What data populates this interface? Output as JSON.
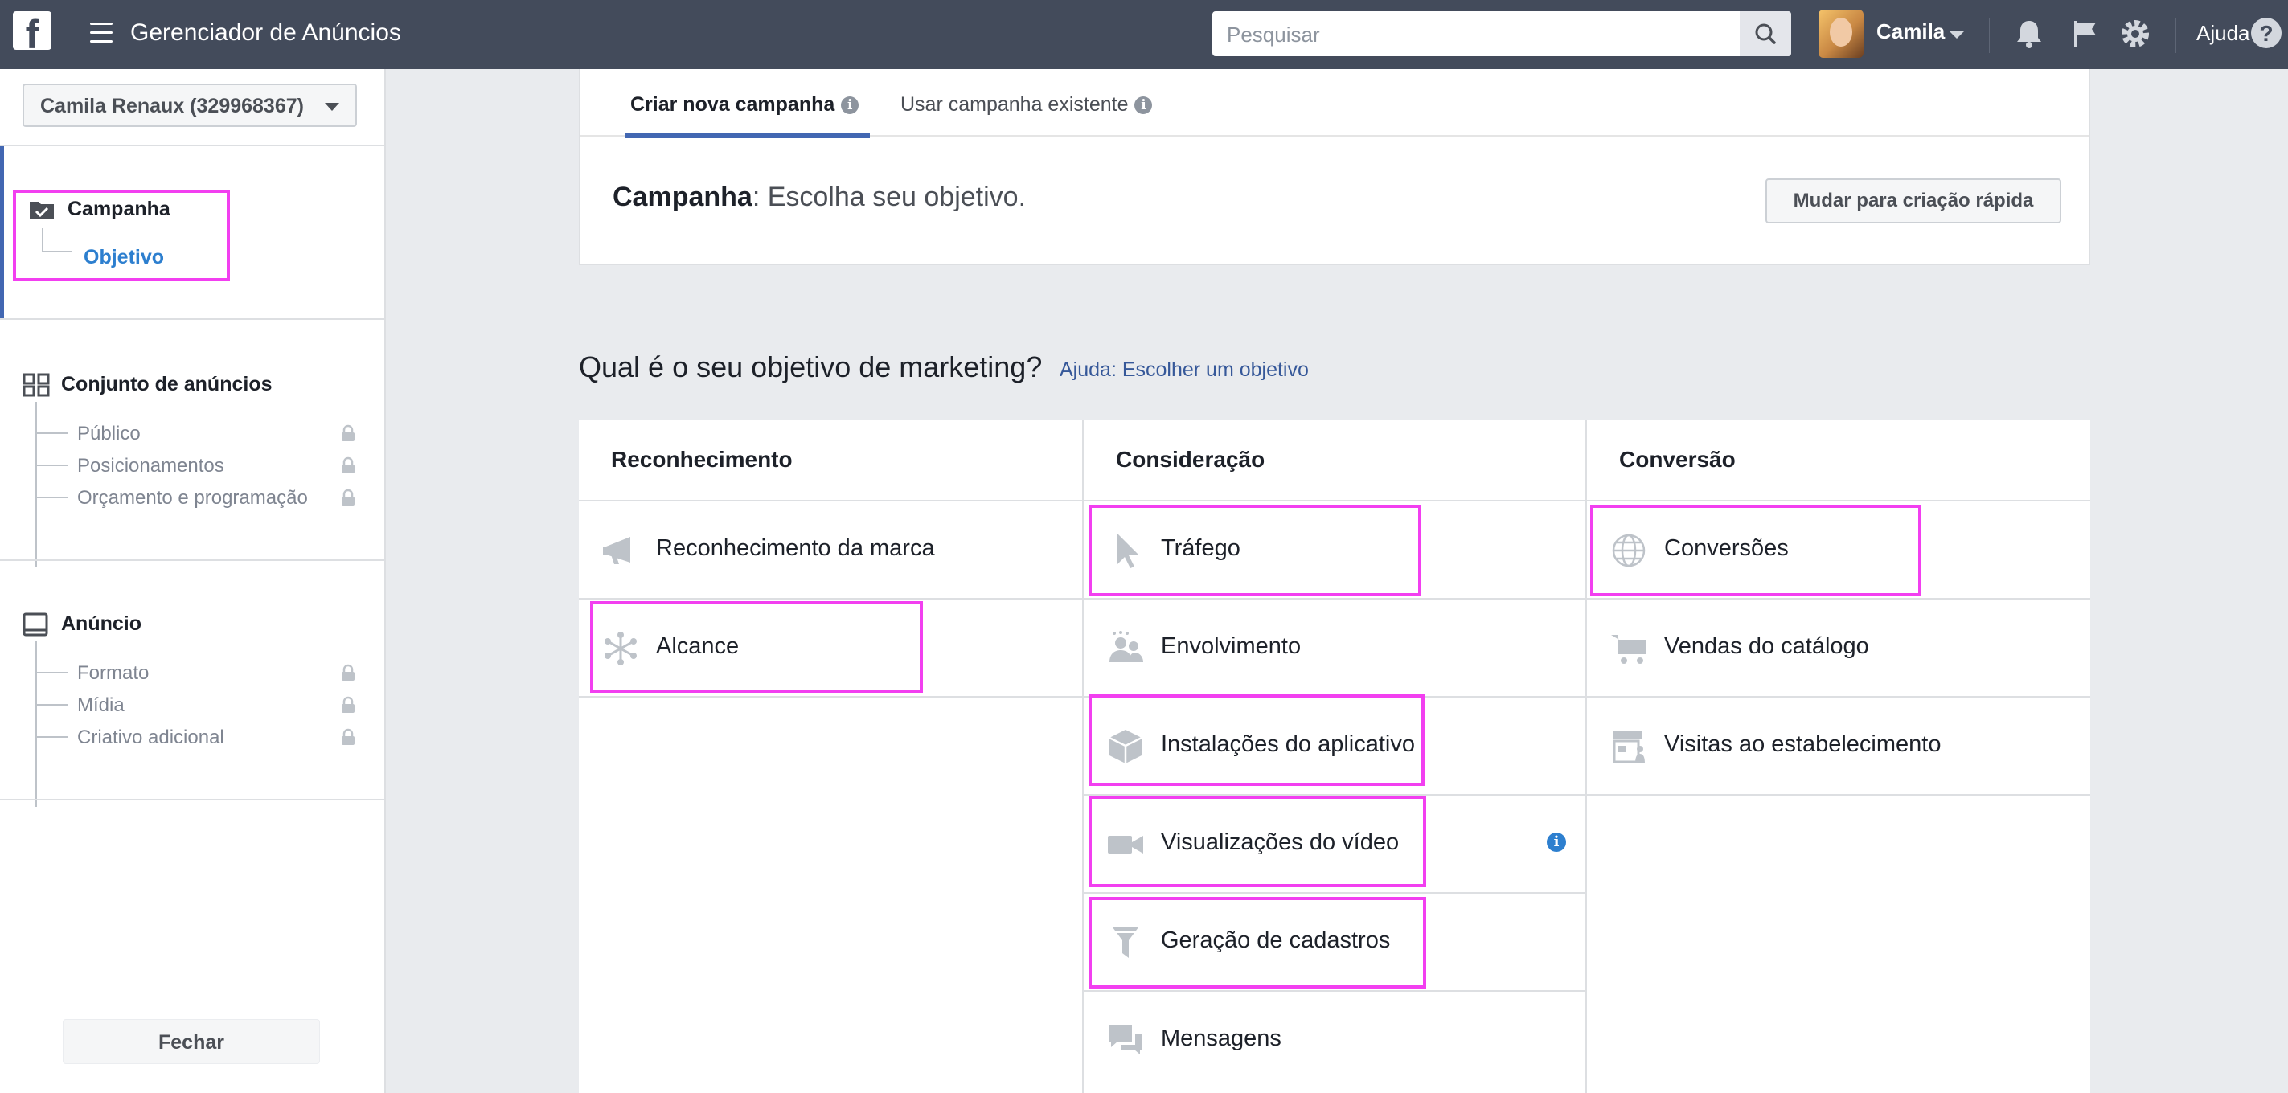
{
  "topbar": {
    "logo": "f",
    "title": "Gerenciador de Anúncios",
    "search_placeholder": "Pesquisar",
    "username": "Camila",
    "help_label": "Ajuda",
    "help_symbol": "?"
  },
  "sidebar": {
    "account": "Camila Renaux (329968367)",
    "campaign": {
      "title": "Campanha",
      "active_sub": "Objetivo"
    },
    "adset": {
      "title": "Conjunto de anúncios",
      "items": [
        "Público",
        "Posicionamentos",
        "Orçamento e programação"
      ]
    },
    "ad": {
      "title": "Anúncio",
      "items": [
        "Formato",
        "Mídia",
        "Criativo adicional"
      ]
    },
    "close": "Fechar"
  },
  "panel": {
    "tabs": [
      "Criar nova campanha",
      "Usar campanha existente"
    ],
    "campaign_label": "Campanha",
    "campaign_rest": ": Escolha seu objetivo.",
    "quick_button": "Mudar para criação rápida"
  },
  "objectives": {
    "question": "Qual é o seu objetivo de marketing?",
    "help_link": "Ajuda: Escolher um objetivo",
    "columns": [
      {
        "title": "Reconhecimento",
        "items": [
          "Reconhecimento da marca",
          "Alcance"
        ]
      },
      {
        "title": "Consideração",
        "items": [
          "Tráfego",
          "Envolvimento",
          "Instalações do aplicativo",
          "Visualizações do vídeo",
          "Geração de cadastros",
          "Mensagens"
        ]
      },
      {
        "title": "Conversão",
        "items": [
          "Conversões",
          "Vendas do catálogo",
          "Visitas ao estabelecimento"
        ]
      }
    ]
  },
  "colors": {
    "topbar": "#434b5b",
    "accent": "#4267b2",
    "highlight": "#f23ff0",
    "link": "#365899"
  }
}
